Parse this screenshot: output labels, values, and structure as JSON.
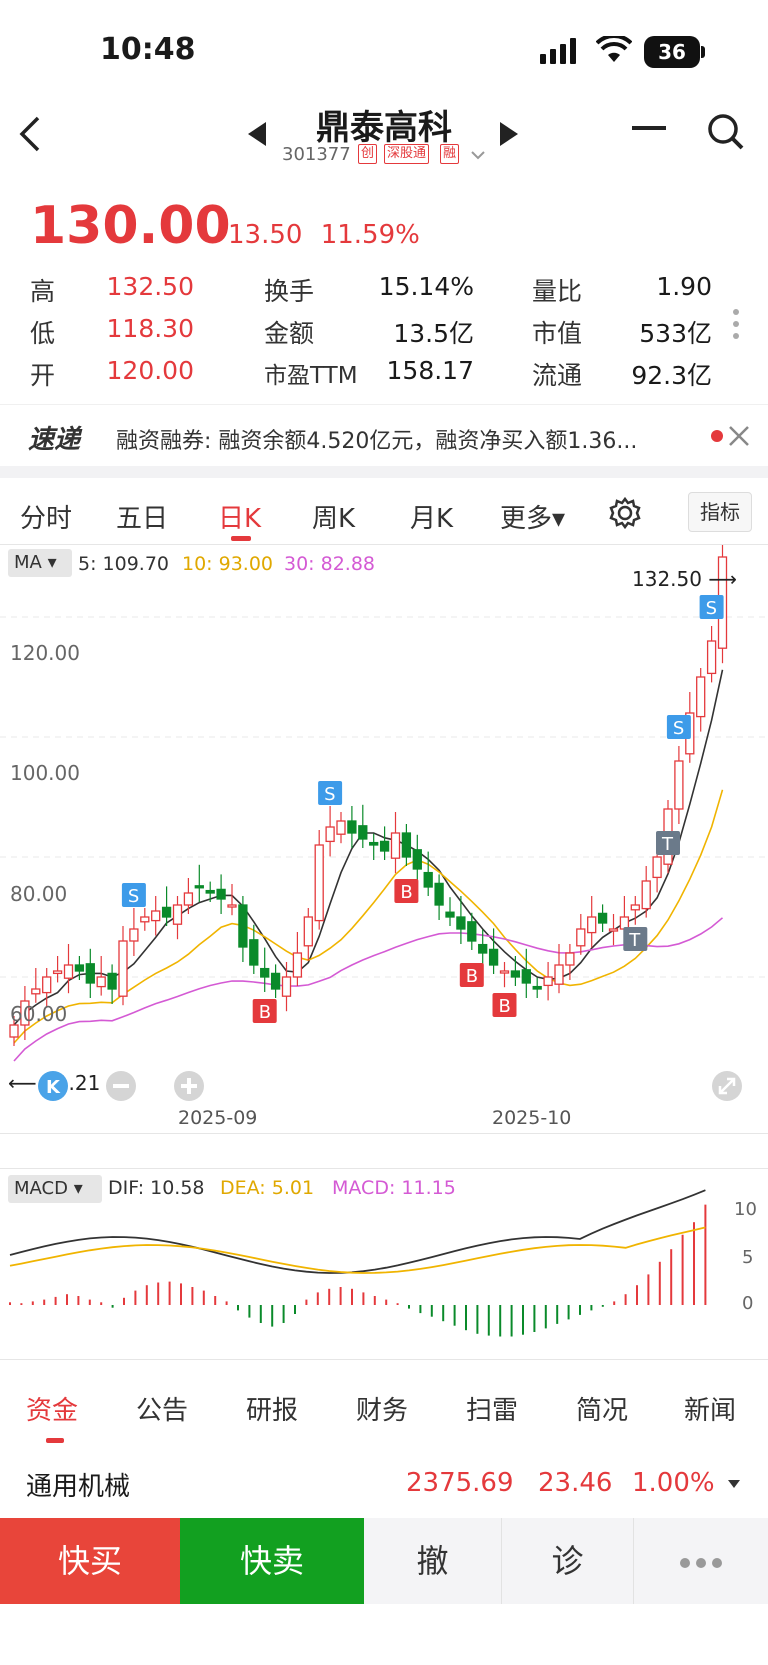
{
  "status": {
    "time": "10:48",
    "battery": "36"
  },
  "header": {
    "title": "鼎泰高科",
    "code": "301377",
    "tags": [
      "创",
      "深股通",
      "融"
    ]
  },
  "quote": {
    "price": "130.00",
    "change": "13.50",
    "pct": "11.59%",
    "rows": [
      {
        "l1": "高",
        "v1": "132.50",
        "l2": "换手",
        "v2": "15.14%",
        "l3": "量比",
        "v3": "1.90"
      },
      {
        "l1": "低",
        "v1": "118.30",
        "l2": "金额",
        "v2": "13.5亿",
        "l3": "市值",
        "v3": "533亿"
      },
      {
        "l1": "开",
        "v1": "120.00",
        "l2": "市盈TTM",
        "v2": "158.17",
        "l3": "流通",
        "v3": "92.3亿"
      }
    ]
  },
  "news": {
    "logo": "速递",
    "text": "融资融券: 融资余额4.520亿元，融资净买入额1.36..."
  },
  "chart_tabs": [
    "分时",
    "五日",
    "日K",
    "周K",
    "月K",
    "更多▾"
  ],
  "indicator_label": "指标",
  "ma_legend": {
    "label": "MA",
    "ma5": "5: 109.70",
    "ma10": "10: 93.00",
    "ma30": "30: 82.88"
  },
  "price_axis": [
    "120.00",
    "100.00",
    "80.00",
    "60.00"
  ],
  "high_marker": "132.50",
  "low_marker": "51.21",
  "dates": [
    "2025-09",
    "2025-10"
  ],
  "macd_legend": {
    "label": "MACD",
    "dif": "DIF: 10.58",
    "dea": "DEA: 5.01",
    "macd": "MACD: 11.15"
  },
  "macd_axis": [
    "10",
    "5",
    "0"
  ],
  "bottom_tabs": [
    "资金",
    "公告",
    "研报",
    "财务",
    "扫雷",
    "简况",
    "新闻"
  ],
  "sector": {
    "name": "通用机械",
    "value": "2375.69",
    "change": "23.46",
    "pct": "1.00%"
  },
  "actions": [
    "快买",
    "快卖",
    "撤",
    "诊"
  ],
  "colors": {
    "up": "#e4393c",
    "down": "#0a8a2a",
    "ma5": "#333333",
    "ma10": "#f0b400",
    "ma30": "#d45ad4"
  }
}
